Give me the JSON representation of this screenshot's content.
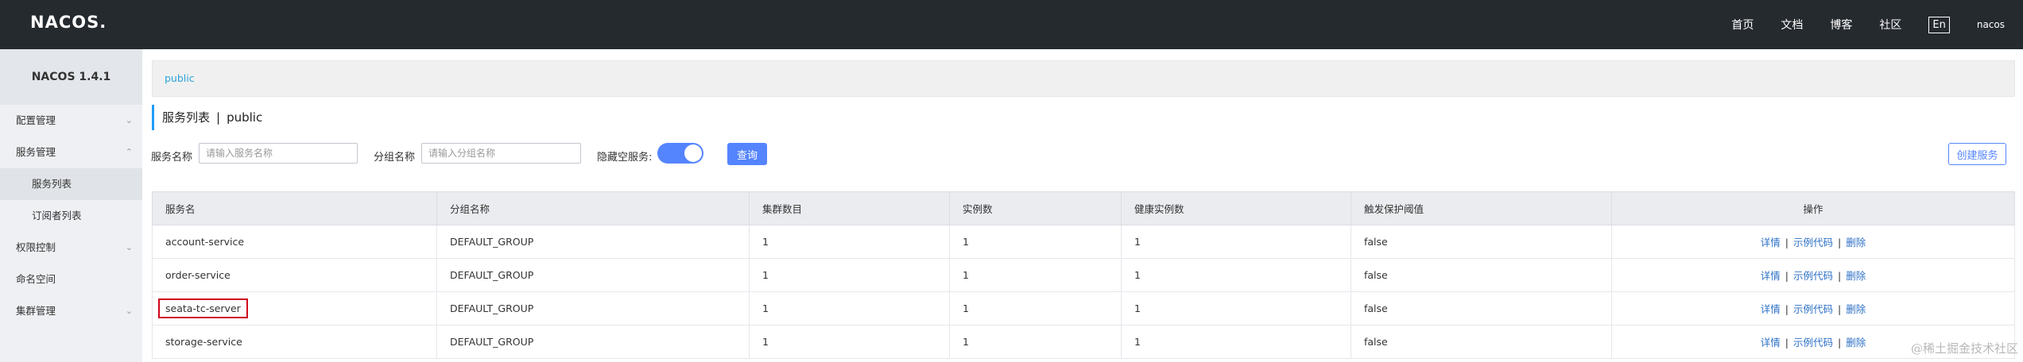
{
  "header": {
    "logo": "NACOS.",
    "nav": [
      "首页",
      "文档",
      "博客",
      "社区"
    ],
    "lang": "En",
    "user": "nacos"
  },
  "sidebar": {
    "version": "NACOS 1.4.1",
    "menu": [
      {
        "label": "配置管理",
        "icon": "chevron-down-icon"
      },
      {
        "label": "服务管理",
        "icon": "chevron-up-icon"
      },
      {
        "label": "服务列表"
      },
      {
        "label": "订阅者列表"
      },
      {
        "label": "权限控制",
        "icon": "chevron-down-icon"
      },
      {
        "label": "命名空间"
      },
      {
        "label": "集群管理",
        "icon": "chevron-down-icon"
      }
    ]
  },
  "namespace": "public",
  "page_title": {
    "title": "服务列表",
    "separator": "|",
    "namespace": "public"
  },
  "filters": {
    "service_label": "服务名称",
    "service_placeholder": "请输入服务名称",
    "group_label": "分组名称",
    "group_placeholder": "请输入分组名称",
    "hide_empty_label": "隐藏空服务:",
    "query_button": "查询",
    "create_button": "创建服务"
  },
  "table": {
    "headers": [
      "服务名",
      "分组名称",
      "集群数目",
      "实例数",
      "健康实例数",
      "触发保护阈值",
      "操作"
    ],
    "rows": [
      [
        "account-service",
        "DEFAULT_GROUP",
        "1",
        "1",
        "1",
        "false"
      ],
      [
        "order-service",
        "DEFAULT_GROUP",
        "1",
        "1",
        "1",
        "false"
      ],
      [
        "seata-tc-server",
        "DEFAULT_GROUP",
        "1",
        "1",
        "1",
        "false"
      ],
      [
        "storage-service",
        "DEFAULT_GROUP",
        "1",
        "1",
        "1",
        "false"
      ]
    ],
    "actions": {
      "detail": "详情",
      "sample": "示例代码",
      "delete": "删除",
      "separator": "|"
    },
    "highlight_color": "#d0021b"
  },
  "watermark": "@稀土掘金技术社区",
  "colors": {
    "header_bg": "#252a2f",
    "primary": "#5584ff",
    "accent": "#209bfa"
  }
}
